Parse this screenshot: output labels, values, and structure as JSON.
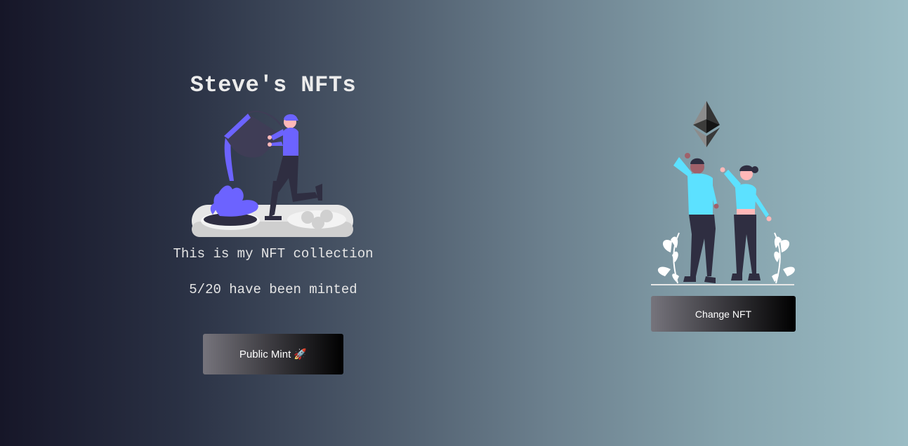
{
  "header": {
    "title": "Steve's NFTs"
  },
  "collection": {
    "description": "This is my NFT collection",
    "mint_status": "5/20 have been minted",
    "minted_count": 5,
    "total_supply": 20
  },
  "actions": {
    "mint_label": "Public Mint 🚀",
    "change_label": "Change NFT"
  },
  "illustrations": {
    "hero": "person-pouring-paint-illustration",
    "ethereum": "ethereum-logo-icon",
    "celebration": "two-people-celebrating-illustration"
  },
  "colors": {
    "gradient_start": "#161628",
    "gradient_end": "#9bbcc4",
    "accent_purple": "#6c63ff",
    "accent_cyan": "#5ce1ff",
    "button_dark": "#000000"
  }
}
